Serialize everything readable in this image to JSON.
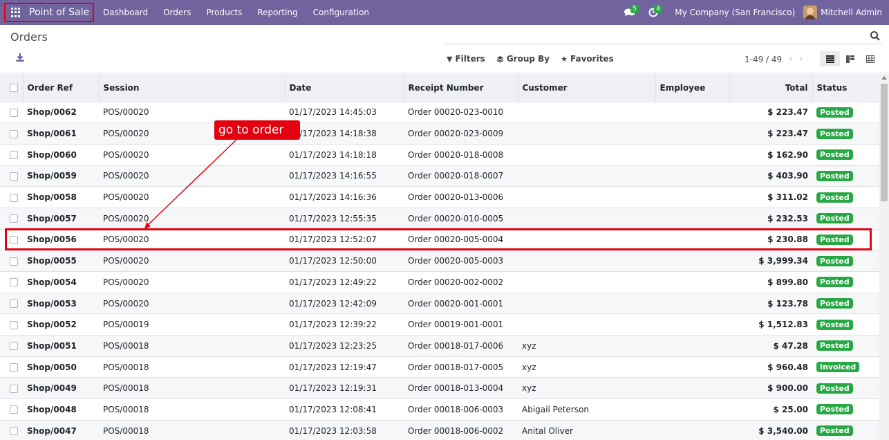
{
  "navbar": {
    "app_title": "Point of Sale",
    "menu": [
      "Dashboard",
      "Orders",
      "Products",
      "Reporting",
      "Configuration"
    ],
    "messages_count": "5",
    "activities_count": "4",
    "company": "My Company (San Francisco)",
    "user": "Mitchell Admin"
  },
  "control": {
    "breadcrumb": "Orders",
    "filters": "Filters",
    "group_by": "Group By",
    "favorites": "Favorites",
    "pager": "1-49 / 49"
  },
  "table": {
    "headers": [
      "Order Ref",
      "Session",
      "Date",
      "Receipt Number",
      "Customer",
      "Employee",
      "Total",
      "Status"
    ],
    "rows": [
      {
        "ref": "Shop/0062",
        "session": "POS/00020",
        "date": "01/17/2023 14:45:03",
        "receipt": "Order 00020-023-0010",
        "customer": "",
        "employee": "",
        "total": "$ 223.47",
        "status": "Posted"
      },
      {
        "ref": "Shop/0061",
        "session": "POS/00020",
        "date": "01/17/2023 14:18:38",
        "receipt": "Order 00020-023-0009",
        "customer": "",
        "employee": "",
        "total": "$ 223.47",
        "status": "Posted"
      },
      {
        "ref": "Shop/0060",
        "session": "POS/00020",
        "date": "01/17/2023 14:18:18",
        "receipt": "Order 00020-018-0008",
        "customer": "",
        "employee": "",
        "total": "$ 162.90",
        "status": "Posted"
      },
      {
        "ref": "Shop/0059",
        "session": "POS/00020",
        "date": "01/17/2023 14:16:55",
        "receipt": "Order 00020-018-0007",
        "customer": "",
        "employee": "",
        "total": "$ 403.90",
        "status": "Posted"
      },
      {
        "ref": "Shop/0058",
        "session": "POS/00020",
        "date": "01/17/2023 14:16:36",
        "receipt": "Order 00020-013-0006",
        "customer": "",
        "employee": "",
        "total": "$ 311.02",
        "status": "Posted"
      },
      {
        "ref": "Shop/0057",
        "session": "POS/00020",
        "date": "01/17/2023 12:55:35",
        "receipt": "Order 00020-010-0005",
        "customer": "",
        "employee": "",
        "total": "$ 232.53",
        "status": "Posted"
      },
      {
        "ref": "Shop/0056",
        "session": "POS/00020",
        "date": "01/17/2023 12:52:07",
        "receipt": "Order 00020-005-0004",
        "customer": "",
        "employee": "",
        "total": "$ 230.88",
        "status": "Posted"
      },
      {
        "ref": "Shop/0055",
        "session": "POS/00020",
        "date": "01/17/2023 12:50:00",
        "receipt": "Order 00020-005-0003",
        "customer": "",
        "employee": "",
        "total": "$ 3,999.34",
        "status": "Posted"
      },
      {
        "ref": "Shop/0054",
        "session": "POS/00020",
        "date": "01/17/2023 12:49:22",
        "receipt": "Order 00020-002-0002",
        "customer": "",
        "employee": "",
        "total": "$ 899.80",
        "status": "Posted"
      },
      {
        "ref": "Shop/0053",
        "session": "POS/00020",
        "date": "01/17/2023 12:42:09",
        "receipt": "Order 00020-001-0001",
        "customer": "",
        "employee": "",
        "total": "$ 123.78",
        "status": "Posted"
      },
      {
        "ref": "Shop/0052",
        "session": "POS/00019",
        "date": "01/17/2023 12:39:22",
        "receipt": "Order 00019-001-0001",
        "customer": "",
        "employee": "",
        "total": "$ 1,512.83",
        "status": "Posted"
      },
      {
        "ref": "Shop/0051",
        "session": "POS/00018",
        "date": "01/17/2023 12:23:25",
        "receipt": "Order 00018-017-0006",
        "customer": "xyz",
        "employee": "",
        "total": "$ 47.28",
        "status": "Posted"
      },
      {
        "ref": "Shop/0050",
        "session": "POS/00018",
        "date": "01/17/2023 12:19:47",
        "receipt": "Order 00018-017-0005",
        "customer": "xyz",
        "employee": "",
        "total": "$ 960.48",
        "status": "Invoiced"
      },
      {
        "ref": "Shop/0049",
        "session": "POS/00018",
        "date": "01/17/2023 12:19:31",
        "receipt": "Order 00018-013-0004",
        "customer": "xyz",
        "employee": "",
        "total": "$ 900.00",
        "status": "Posted"
      },
      {
        "ref": "Shop/0048",
        "session": "POS/00018",
        "date": "01/17/2023 12:08:41",
        "receipt": "Order 00018-006-0003",
        "customer": "Abigail Peterson",
        "employee": "",
        "total": "$ 25.00",
        "status": "Posted"
      },
      {
        "ref": "Shop/0047",
        "session": "POS/00018",
        "date": "01/17/2023 12:03:58",
        "receipt": "Order 00018-006-0002",
        "customer": "Anital Oliver",
        "employee": "",
        "total": "$ 3,540.00",
        "status": "Posted"
      }
    ]
  },
  "annotation": {
    "callout": "go to order"
  },
  "colors": {
    "navbar": "#71639e",
    "status_badge": "#28a745",
    "annotation": "#e3000f"
  }
}
